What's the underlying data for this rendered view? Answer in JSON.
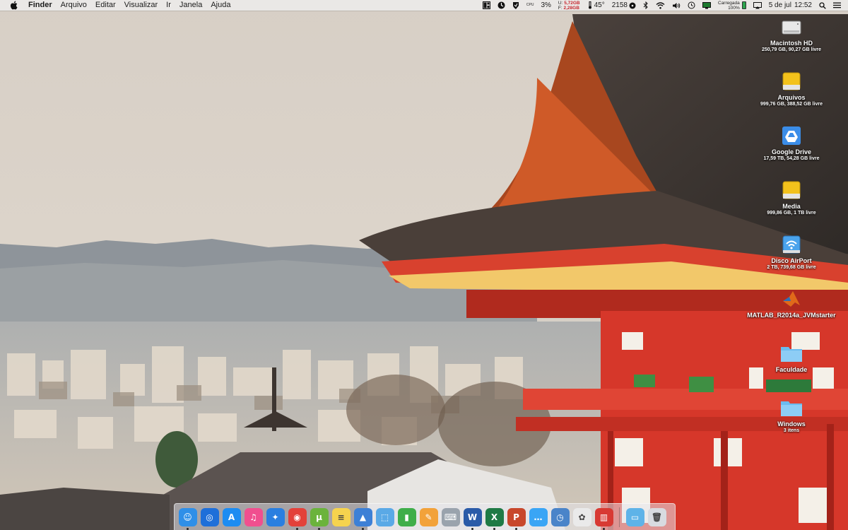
{
  "menubar": {
    "app_name": "Finder",
    "items": [
      "Arquivo",
      "Editar",
      "Visualizar",
      "Ir",
      "Janela",
      "Ajuda"
    ],
    "status": {
      "cpu": "3%",
      "cpu_letters": "CPU",
      "mem_used_label": "U:",
      "mem_used": "5,72GB",
      "mem_free_label": "F:",
      "mem_free": "2,28GB",
      "temperature": "45°",
      "fan": "2158",
      "battery_status": "Carregada",
      "battery_pct": "100%",
      "date": "5 de jul",
      "time": "12:52"
    }
  },
  "desktop_icons": [
    {
      "name": "Macintosh HD",
      "info": "250,79 GB, 90,27 GB livre",
      "icon": "internal-disk-icon"
    },
    {
      "name": "Arquivos",
      "info": "999,76 GB, 388,52 GB livre",
      "icon": "external-disk-icon"
    },
    {
      "name": "Google Drive",
      "info": "17,59 TB, 54,28 GB livre",
      "icon": "google-drive-icon"
    },
    {
      "name": "Media",
      "info": "999,86 GB, 1 TB livre",
      "icon": "external-disk-icon"
    },
    {
      "name": "Disco AirPort",
      "info": "2 TB, 739,68 GB livre",
      "icon": "airport-disk-icon"
    },
    {
      "name": "MATLAB_R2014a_JVMstarter",
      "info": "",
      "icon": "matlab-icon"
    },
    {
      "name": "Faculdade",
      "info": "",
      "icon": "folder-icon"
    },
    {
      "name": "Windows",
      "info": "3 itens",
      "icon": "folder-icon"
    }
  ],
  "dock": [
    {
      "name": "finder-icon",
      "color": "#2f8fe8",
      "glyph": "☺",
      "running": true
    },
    {
      "name": "airdrop-icon",
      "color": "#1e6fd9",
      "glyph": "◎",
      "running": false
    },
    {
      "name": "app-store-icon",
      "color": "#1c8cf2",
      "glyph": "A",
      "running": false
    },
    {
      "name": "itunes-icon",
      "color": "#f04f8f",
      "glyph": "♫",
      "running": false
    },
    {
      "name": "safari-icon",
      "color": "#2a7fe0",
      "glyph": "✦",
      "running": false
    },
    {
      "name": "chrome-icon",
      "color": "#e3413a",
      "glyph": "◉",
      "running": true
    },
    {
      "name": "utorrent-icon",
      "color": "#6bb33c",
      "glyph": "µ",
      "running": true
    },
    {
      "name": "notes-icon",
      "color": "#f6d34e",
      "glyph": "≡",
      "running": false
    },
    {
      "name": "keynote-icon",
      "color": "#3d80d6",
      "glyph": "▲",
      "running": true
    },
    {
      "name": "preview-icon",
      "color": "#5aa9e6",
      "glyph": "⬚",
      "running": false
    },
    {
      "name": "numbers-icon",
      "color": "#3fae4a",
      "glyph": "▮",
      "running": false
    },
    {
      "name": "pages-icon",
      "color": "#f2a23a",
      "glyph": "✎",
      "running": false
    },
    {
      "name": "keyboard-icon",
      "color": "#9aa3ad",
      "glyph": "⌨",
      "running": false
    },
    {
      "name": "word-icon",
      "color": "#2a5ba8",
      "glyph": "W",
      "running": true
    },
    {
      "name": "excel-icon",
      "color": "#1f7a45",
      "glyph": "X",
      "running": true
    },
    {
      "name": "powerpoint-icon",
      "color": "#c8472b",
      "glyph": "P",
      "running": true
    },
    {
      "name": "messages-icon",
      "color": "#3aa5f5",
      "glyph": "…",
      "running": false
    },
    {
      "name": "clock-icon",
      "color": "#4a84c9",
      "glyph": "◷",
      "running": false
    },
    {
      "name": "photos-icon",
      "color": "#eaeaea",
      "glyph": "✿",
      "running": false
    },
    {
      "name": "parallels-icon",
      "color": "#d83a33",
      "glyph": "▥",
      "running": true
    }
  ],
  "dock_right": [
    {
      "name": "downloads-folder-icon",
      "color": "#5eb3e8",
      "glyph": "▭"
    },
    {
      "name": "trash-icon",
      "color": "#d8dbe0",
      "glyph": "🗑"
    }
  ]
}
